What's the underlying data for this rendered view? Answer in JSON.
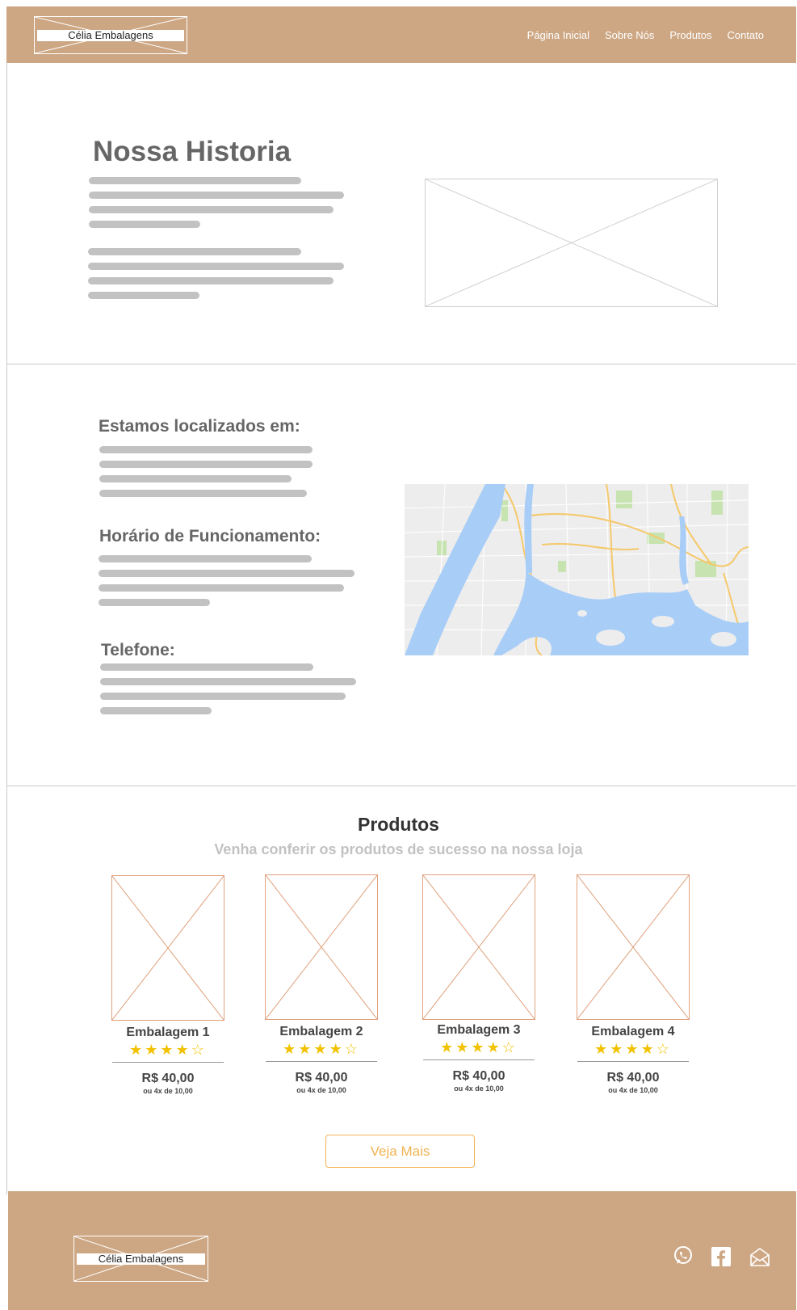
{
  "header": {
    "logo_text": "Célia Embalagens",
    "nav": [
      "Página Inicial",
      "Sobre Nós",
      "Produtos",
      "Contato"
    ]
  },
  "history": {
    "title": "Nossa Historia"
  },
  "location": {
    "address_heading": "Estamos localizados em:",
    "hours_heading": "Horário de Funcionamento:",
    "phone_heading": "Telefone:"
  },
  "products": {
    "title": "Produtos",
    "subtitle": "Venha conferir os produtos de sucesso na nossa loja",
    "items": [
      {
        "name": "Embalagem 1",
        "rating": 4,
        "rating_max": 5,
        "price": "R$ 40,00",
        "installments": "ou 4x de 10,00"
      },
      {
        "name": "Embalagem 2",
        "rating": 4,
        "rating_max": 5,
        "price": "R$ 40,00",
        "installments": "ou 4x de 10,00"
      },
      {
        "name": "Embalagem 3",
        "rating": 4,
        "rating_max": 5,
        "price": "R$ 40,00",
        "installments": "ou 4x de 10,00"
      },
      {
        "name": "Embalagem 4",
        "rating": 4,
        "rating_max": 5,
        "price": "R$ 40,00",
        "installments": "ou 4x de 10,00"
      }
    ],
    "more_button": "Veja Mais"
  },
  "footer": {
    "logo_text": "Célia Embalagens",
    "social_icons": [
      "whatsapp-icon",
      "facebook-icon",
      "email-icon"
    ]
  },
  "colors": {
    "brand": "#cda784",
    "accent": "#f0b453",
    "star": "#f2c200",
    "placeholder_text": "#c2c2c2"
  }
}
